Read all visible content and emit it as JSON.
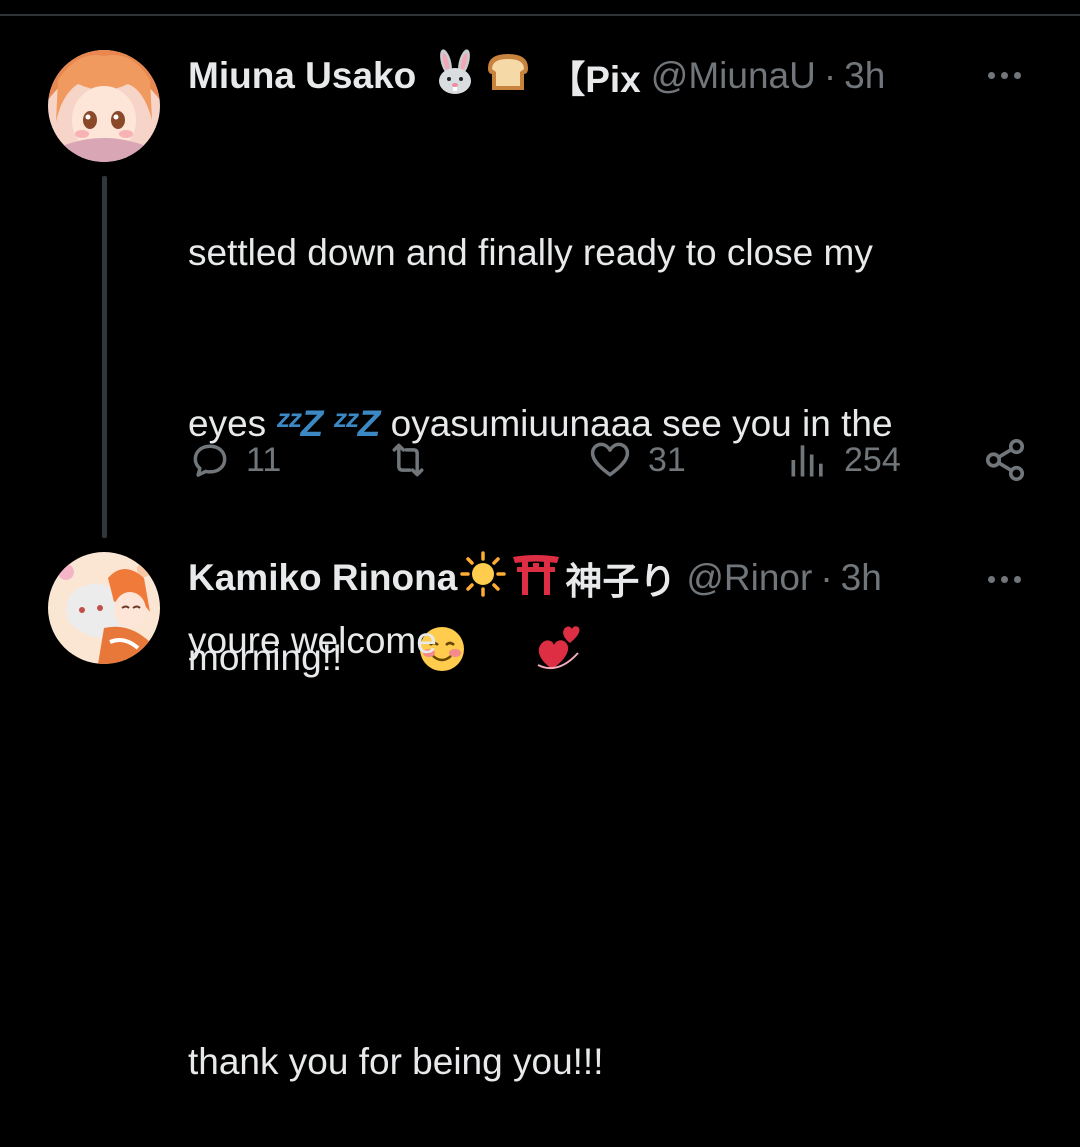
{
  "tweet": {
    "author_name": "Miuna Usako",
    "name_suffix": "【Pix",
    "handle": "@MiunaU",
    "separator": "·",
    "time": "3h",
    "text_line1": "settled down and finally ready to close my",
    "text_line2_pre": "eyes ",
    "text_zzz": "ᶻᶻZ ᶻᶻZ",
    "text_line2_post": " oyasumiuunaaa see you in the",
    "text_line3": "morning!!",
    "text_line5": "thank you for being you!!!",
    "icons": [
      "rabbit-icon",
      "bread-icon",
      "smiling-face-icon",
      "revolving-hearts-icon"
    ],
    "actions": {
      "replies": "11",
      "retweets": "",
      "likes": "31",
      "views": "254"
    }
  },
  "reply": {
    "author_name": "Kamiko Rinona",
    "name_suffix": "神子り",
    "handle": "@Rinor",
    "separator": "·",
    "time": "3h",
    "text": "youre welcome",
    "icons": [
      "sun-icon",
      "torii-gate-icon"
    ]
  },
  "colors": {
    "background": "#000000",
    "text": "#e7e9ea",
    "secondary": "#71767b",
    "divider": "#2f3336"
  }
}
